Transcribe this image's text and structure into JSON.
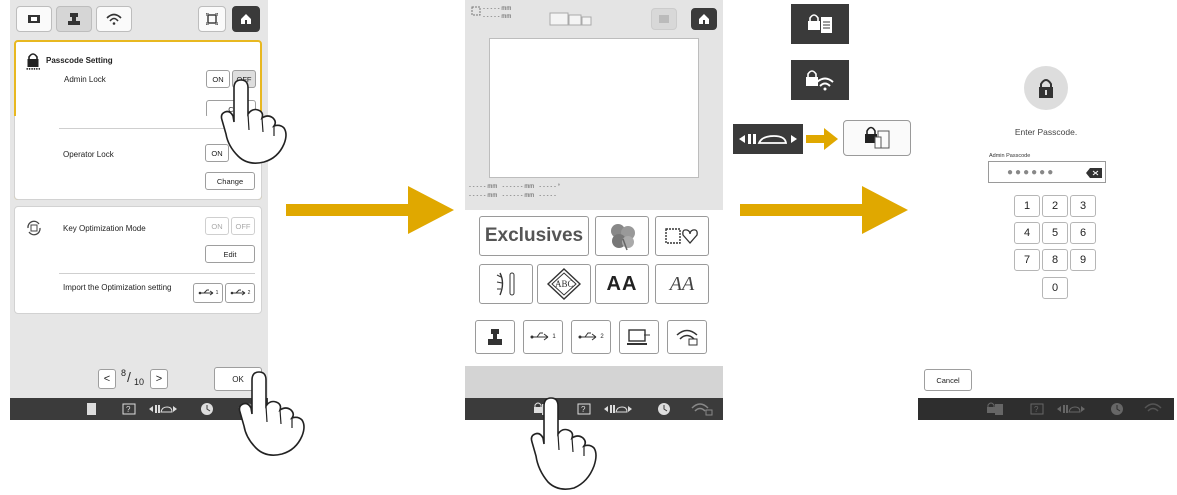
{
  "panel1": {
    "passcode": {
      "title": "Passcode Setting",
      "admin_lock_label": "Admin Lock",
      "on_label": "ON",
      "off_label": "OFF",
      "change_label": "C",
      "operator_lock_label": "Operator Lock",
      "operator_on_label": "ON",
      "change_button": "Change"
    },
    "key_opt": {
      "title": "Key Optimization Mode",
      "on_label": "ON",
      "off_label": "OFF",
      "edit_label": "Edit",
      "import_label": "Import the Optimization setting",
      "usb1_sub": "1",
      "usb2_sub": "2"
    },
    "pager": {
      "prev": "<",
      "current": "8",
      "total": "10",
      "next": ">"
    },
    "ok_label": "OK",
    "highlight_color": "#e8b820"
  },
  "panel2": {
    "measure_top": "- - - - - mm",
    "measure_top2": "- - - - - mm",
    "exclusives_label": "Exclusives",
    "alpha_label": "AA",
    "script_label": "AA",
    "monogram_label": "ABC",
    "usb1_sub": "1",
    "usb2_sub": "2",
    "measure_row1": "- - - - - mm   - - - - - - mm   - - - - - °",
    "measure_row2": "- - - - - mm   - - - - - - mm   - - - - -"
  },
  "legend": {
    "icons": [
      "lock-document-icon",
      "lock-wifi-icon",
      "needle-presser-icon",
      "lock-document-button-icon"
    ]
  },
  "panel3": {
    "prompt": "Enter Passcode.",
    "field_label": "Admin Passcode",
    "mask": "●●●●●●",
    "keys": [
      "1",
      "2",
      "3",
      "4",
      "5",
      "6",
      "7",
      "8",
      "9",
      "0"
    ],
    "cancel_label": "Cancel"
  },
  "colors": {
    "arrow": "#e0a800",
    "statusbar": "#3b3b3b"
  }
}
